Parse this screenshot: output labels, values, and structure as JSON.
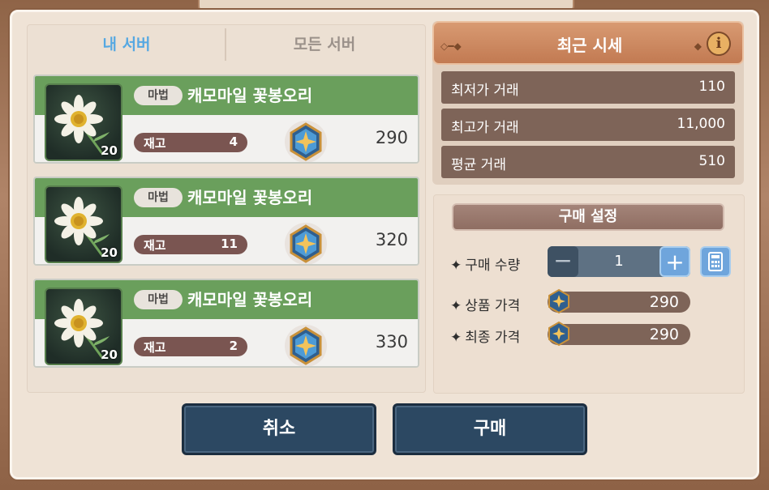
{
  "tabs": {
    "my_server": "내 서버",
    "all_servers": "모든 서버"
  },
  "items": [
    {
      "category": "마법",
      "name": "캐모마일 꽃봉오리",
      "count": "20",
      "stock_label": "재고",
      "stock": "4",
      "price": "290"
    },
    {
      "category": "마법",
      "name": "캐모마일 꽃봉오리",
      "count": "20",
      "stock_label": "재고",
      "stock": "11",
      "price": "320"
    },
    {
      "category": "마법",
      "name": "캐모마일 꽃봉오리",
      "count": "20",
      "stock_label": "재고",
      "stock": "2",
      "price": "330"
    }
  ],
  "market": {
    "title": "최근 시세",
    "rows": [
      {
        "label": "최저가 거래",
        "value": "110"
      },
      {
        "label": "최고가 거래",
        "value": "11,000"
      },
      {
        "label": "평균 거래",
        "value": "510"
      }
    ]
  },
  "purchase": {
    "title": "구매 설정",
    "quantity_label": "구매 수량",
    "quantity": "1",
    "item_price_label": "상품 가격",
    "item_price": "290",
    "final_price_label": "최종 가격",
    "final_price": "290"
  },
  "buttons": {
    "cancel": "취소",
    "buy": "구매"
  },
  "colors": {
    "tab_active": "#55a8e2",
    "item_header": "#6a9f5c",
    "button": "#2c4862",
    "market_header": "#c8825a"
  }
}
